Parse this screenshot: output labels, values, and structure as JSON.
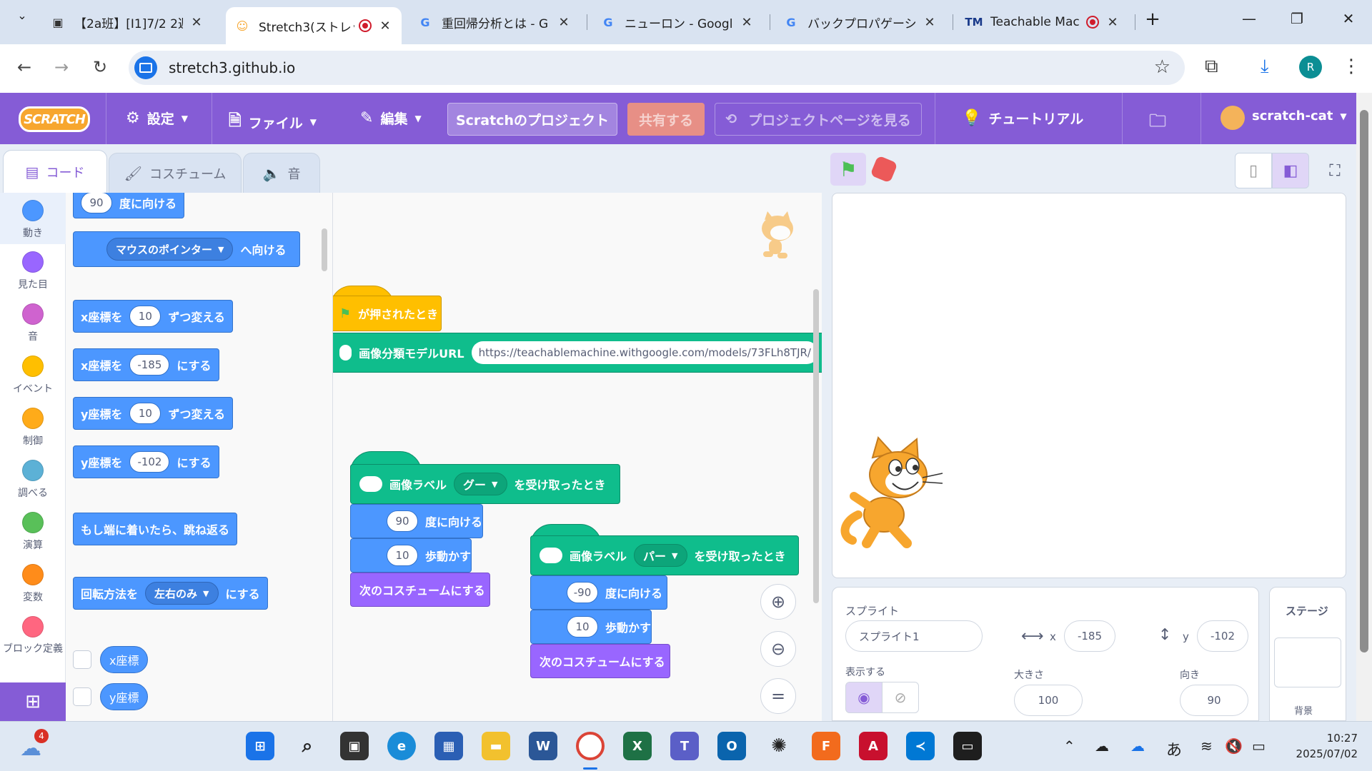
{
  "browser": {
    "tabs": [
      {
        "title": "【2a班】[I1]7/2 2週",
        "favicon": "classroom-icon",
        "recording": false
      },
      {
        "title": "Stretch3(ストレッ",
        "favicon": "scratch-cat-icon",
        "recording": true,
        "active": true
      },
      {
        "title": "重回帰分析とは - G",
        "favicon": "google-icon",
        "recording": false
      },
      {
        "title": "ニューロン - Google",
        "favicon": "google-icon",
        "recording": false
      },
      {
        "title": "バックプロパゲーション",
        "favicon": "google-icon",
        "recording": false
      },
      {
        "title": "Teachable Mac",
        "favicon": "teachable-machine-icon",
        "recording": true
      }
    ],
    "new_tab": "+",
    "url": "stretch3.github.io",
    "profile_initial": "R"
  },
  "menubar": {
    "logo": "SCRATCH",
    "settings": "設定",
    "file": "ファイル",
    "edit": "編集",
    "project_title": "Scratchのプロジェクト",
    "share": "共有する",
    "see_project_page": "プロジェクトページを見る",
    "tutorials": "チュートリアル",
    "username": "scratch-cat"
  },
  "editor_tabs": {
    "code": "コード",
    "costumes": "コスチューム",
    "sounds": "音"
  },
  "categories": [
    {
      "label": "動き",
      "color": "#4c97ff"
    },
    {
      "label": "見た目",
      "color": "#9966ff"
    },
    {
      "label": "音",
      "color": "#cf63cf"
    },
    {
      "label": "イベント",
      "color": "#ffbf00"
    },
    {
      "label": "制御",
      "color": "#ffab19"
    },
    {
      "label": "調べる",
      "color": "#5cb1d6"
    },
    {
      "label": "演算",
      "color": "#59c059"
    },
    {
      "label": "変数",
      "color": "#ff8c1a"
    },
    {
      "label": "ブロック定義",
      "color": "#ff6680"
    }
  ],
  "palette": {
    "point_dir_value": "90",
    "point_dir_label": "度に向ける",
    "point_towards_option": "マウスのポインター",
    "point_towards_label": "へ向ける",
    "change_x_label": "x座標を",
    "change_x_value": "10",
    "change_x_suffix": "ずつ変える",
    "set_x_label": "x座標を",
    "set_x_value": "-185",
    "set_x_suffix": "にする",
    "change_y_label": "y座標を",
    "change_y_value": "10",
    "change_y_suffix": "ずつ変える",
    "set_y_label": "y座標を",
    "set_y_value": "-102",
    "set_y_suffix": "にする",
    "bounce": "もし端に着いたら、跳ね返る",
    "rotation_label": "回転方法を",
    "rotation_option": "左右のみ",
    "rotation_suffix": "にする",
    "x_reporter": "x座標",
    "y_reporter": "y座標"
  },
  "scripts": {
    "flag_hat": "が押されたとき",
    "model_url_label": "画像分類モデルURL",
    "model_url": "https://teachablemachine.withgoogle.com/models/73FLh8TJR/",
    "goo": {
      "hat_label": "画像ラベル",
      "option": "グー",
      "hat_suffix": "を受け取ったとき",
      "dir_value": "90",
      "dir_label": "度に向ける",
      "move_value": "10",
      "move_label": "歩動かす",
      "next_costume": "次のコスチュームにする"
    },
    "paa": {
      "hat_label": "画像ラベル",
      "option": "パー",
      "hat_suffix": "を受け取ったとき",
      "dir_value": "-90",
      "dir_label": "度に向ける",
      "move_value": "10",
      "move_label": "歩動かす",
      "next_costume": "次のコスチュームにする"
    }
  },
  "sprite_info": {
    "sprite_label": "スプライト",
    "sprite_name": "スプライト1",
    "x_label": "x",
    "x_value": "-185",
    "y_label": "y",
    "y_value": "-102",
    "show_label": "表示する",
    "size_label": "大きさ",
    "size_value": "100",
    "direction_label": "向き",
    "direction_value": "90"
  },
  "stage_pane": {
    "title": "ステージ",
    "backdrop_label": "背景"
  },
  "taskbar": {
    "weather_badge": "4",
    "ime": "あ",
    "time": "10:27",
    "date": "2025/07/02"
  }
}
